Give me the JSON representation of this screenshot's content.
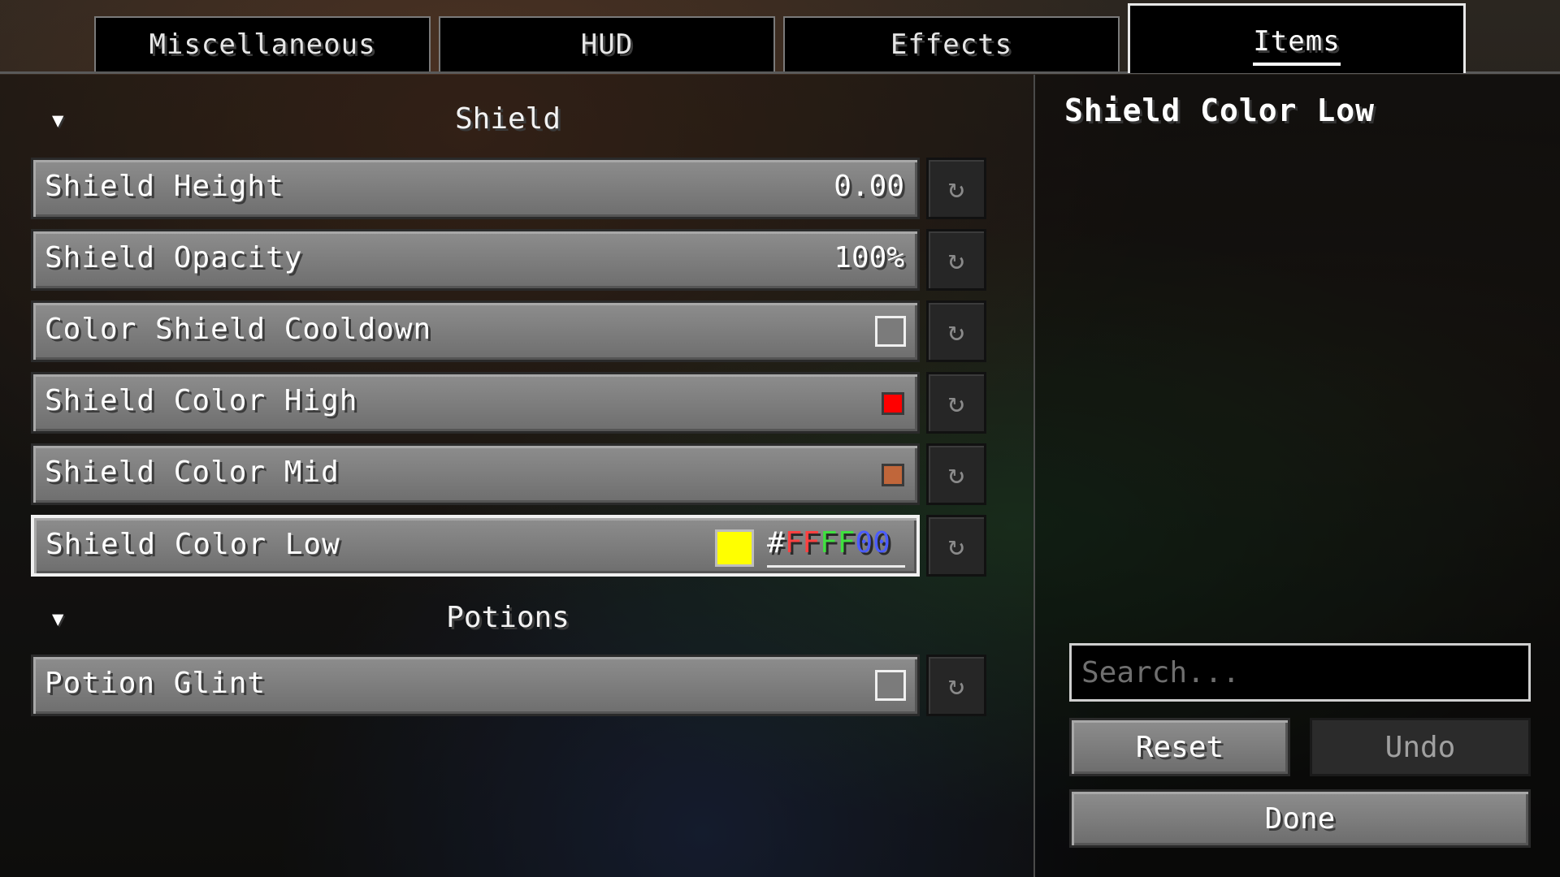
{
  "tabs": [
    {
      "label": "Miscellaneous",
      "active": false
    },
    {
      "label": "HUD",
      "active": false
    },
    {
      "label": "Effects",
      "active": false
    },
    {
      "label": "Items",
      "active": true
    }
  ],
  "sections": {
    "shield": {
      "title": "Shield",
      "collapse_glyph": "▼"
    },
    "potions": {
      "title": "Potions",
      "collapse_glyph": "▼"
    }
  },
  "options": {
    "shield_height": {
      "label": "Shield Height",
      "value": "0.00"
    },
    "shield_opacity": {
      "label": "Shield Opacity",
      "value": "100%"
    },
    "color_shield_cooldown": {
      "label": "Color Shield Cooldown",
      "checked": false
    },
    "shield_color_high": {
      "label": "Shield Color High",
      "color": "#ff0000"
    },
    "shield_color_mid": {
      "label": "Shield Color Mid",
      "color": "#c0663a"
    },
    "shield_color_low": {
      "label": "Shield Color Low",
      "color": "#ffff00",
      "hex": {
        "hash": "#",
        "r": "FF",
        "g": "FF",
        "b": "00"
      }
    },
    "potion_glint": {
      "label": "Potion Glint",
      "checked": false
    }
  },
  "reset_glyph": "↻",
  "sidebar": {
    "description_title": "Shield Color Low",
    "search_placeholder": "Search...",
    "reset_label": "Reset",
    "undo_label": "Undo",
    "done_label": "Done"
  },
  "colors": {
    "hex_red": "#ff4040",
    "hex_green": "#40e040",
    "hex_blue": "#4a5cff"
  }
}
